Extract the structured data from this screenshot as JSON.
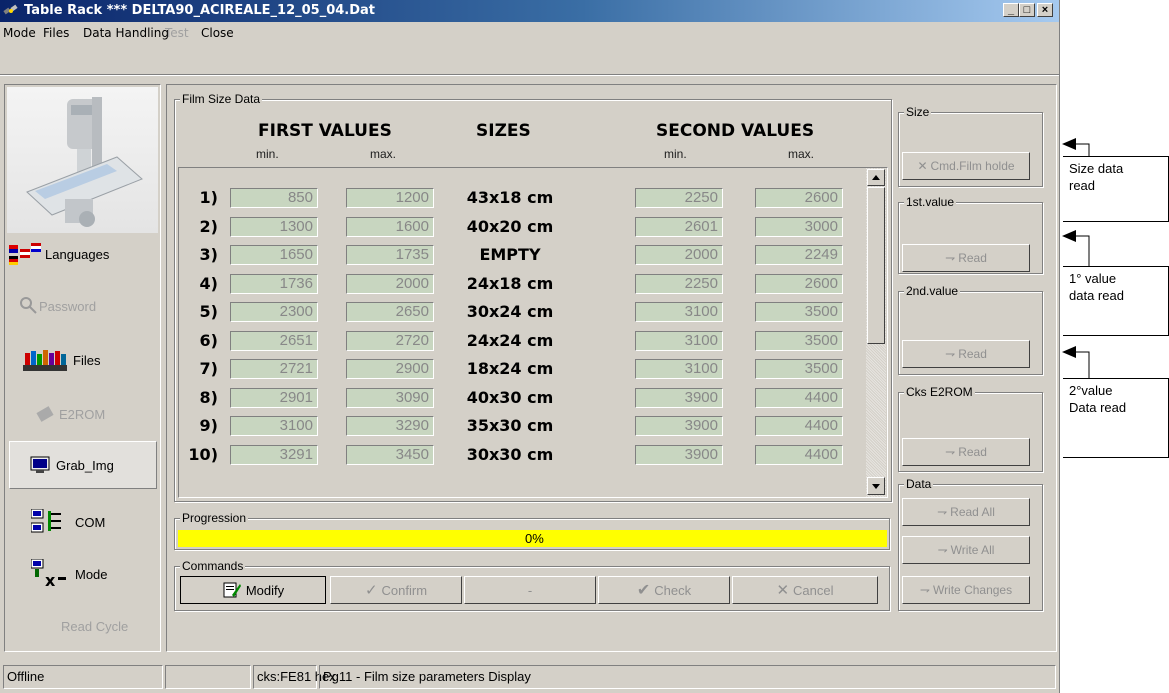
{
  "window": {
    "title": "Table Rack *** DELTA90_ACIREALE_12_05_04.Dat"
  },
  "menu": [
    {
      "label": "Mode",
      "disabled": false
    },
    {
      "label": "Files",
      "disabled": false
    },
    {
      "label": "Data Handling",
      "disabled": false
    },
    {
      "label": "Test",
      "disabled": true
    },
    {
      "label": "Close",
      "disabled": false
    }
  ],
  "sidebar": {
    "items": [
      {
        "label": "Languages",
        "icon": "flags-icon"
      },
      {
        "label": "Password",
        "icon": "key-icon",
        "disabled": true
      },
      {
        "label": "Files",
        "icon": "books-icon"
      },
      {
        "label": "E2ROM",
        "icon": "chip-icon",
        "disabled": true
      },
      {
        "label": "Grab_Img",
        "icon": "monitor-icon"
      },
      {
        "label": "COM",
        "icon": "com-icon"
      },
      {
        "label": "Mode",
        "icon": "mode-icon"
      },
      {
        "label": "Read Cycle",
        "disabled": true
      }
    ]
  },
  "film": {
    "group_label": "Film Size Data",
    "first_values": "FIRST VALUES",
    "sizes": "SIZES",
    "second_values": "SECOND VALUES",
    "min": "min.",
    "max": "max.",
    "rows": [
      {
        "n": "1)",
        "f_min": "850",
        "f_max": "1200",
        "size": "43x18 cm",
        "s_min": "2250",
        "s_max": "2600"
      },
      {
        "n": "2)",
        "f_min": "1300",
        "f_max": "1600",
        "size": "40x20 cm",
        "s_min": "2601",
        "s_max": "3000"
      },
      {
        "n": "3)",
        "f_min": "1650",
        "f_max": "1735",
        "size": "EMPTY",
        "s_min": "2000",
        "s_max": "2249"
      },
      {
        "n": "4)",
        "f_min": "1736",
        "f_max": "2000",
        "size": "24x18 cm",
        "s_min": "2250",
        "s_max": "2600"
      },
      {
        "n": "5)",
        "f_min": "2300",
        "f_max": "2650",
        "size": "30x24 cm",
        "s_min": "3100",
        "s_max": "3500"
      },
      {
        "n": "6)",
        "f_min": "2651",
        "f_max": "2720",
        "size": "24x24 cm",
        "s_min": "3100",
        "s_max": "3500"
      },
      {
        "n": "7)",
        "f_min": "2721",
        "f_max": "2900",
        "size": "18x24 cm",
        "s_min": "3100",
        "s_max": "3500"
      },
      {
        "n": "8)",
        "f_min": "2901",
        "f_max": "3090",
        "size": "40x30 cm",
        "s_min": "3900",
        "s_max": "4400"
      },
      {
        "n": "9)",
        "f_min": "3100",
        "f_max": "3290",
        "size": "35x30 cm",
        "s_min": "3900",
        "s_max": "4400"
      },
      {
        "n": "10)",
        "f_min": "3291",
        "f_max": "3450",
        "size": "30x30 cm",
        "s_min": "3900",
        "s_max": "4400"
      }
    ]
  },
  "progression": {
    "label": "Progression",
    "percent_text": "0%",
    "value": 0,
    "bar_color": "#ffff00"
  },
  "commands": {
    "label": "Commands",
    "modify": "Modify",
    "confirm": "Confirm",
    "dash": "-",
    "check": "Check",
    "cancel": "Cancel"
  },
  "right": {
    "size_label": "Size",
    "cmd_film": "Cmd.Film holde",
    "first_label": "1st.value",
    "second_label": "2nd.value",
    "cks_label": "Cks E2ROM",
    "read": "Read",
    "data_label": "Data",
    "read_all": "Read All",
    "write_all": "Write All",
    "write_changes": "Write Changes"
  },
  "status": {
    "conn": "Offline",
    "blank": "",
    "cks": "cks:FE81 hex",
    "page": "Pg11 - Film size parameters Display"
  },
  "annotations": {
    "a1": [
      "Size data",
      "read"
    ],
    "a2": [
      "1° value",
      "data read"
    ],
    "a3": [
      " 2°value",
      "Data read"
    ]
  }
}
